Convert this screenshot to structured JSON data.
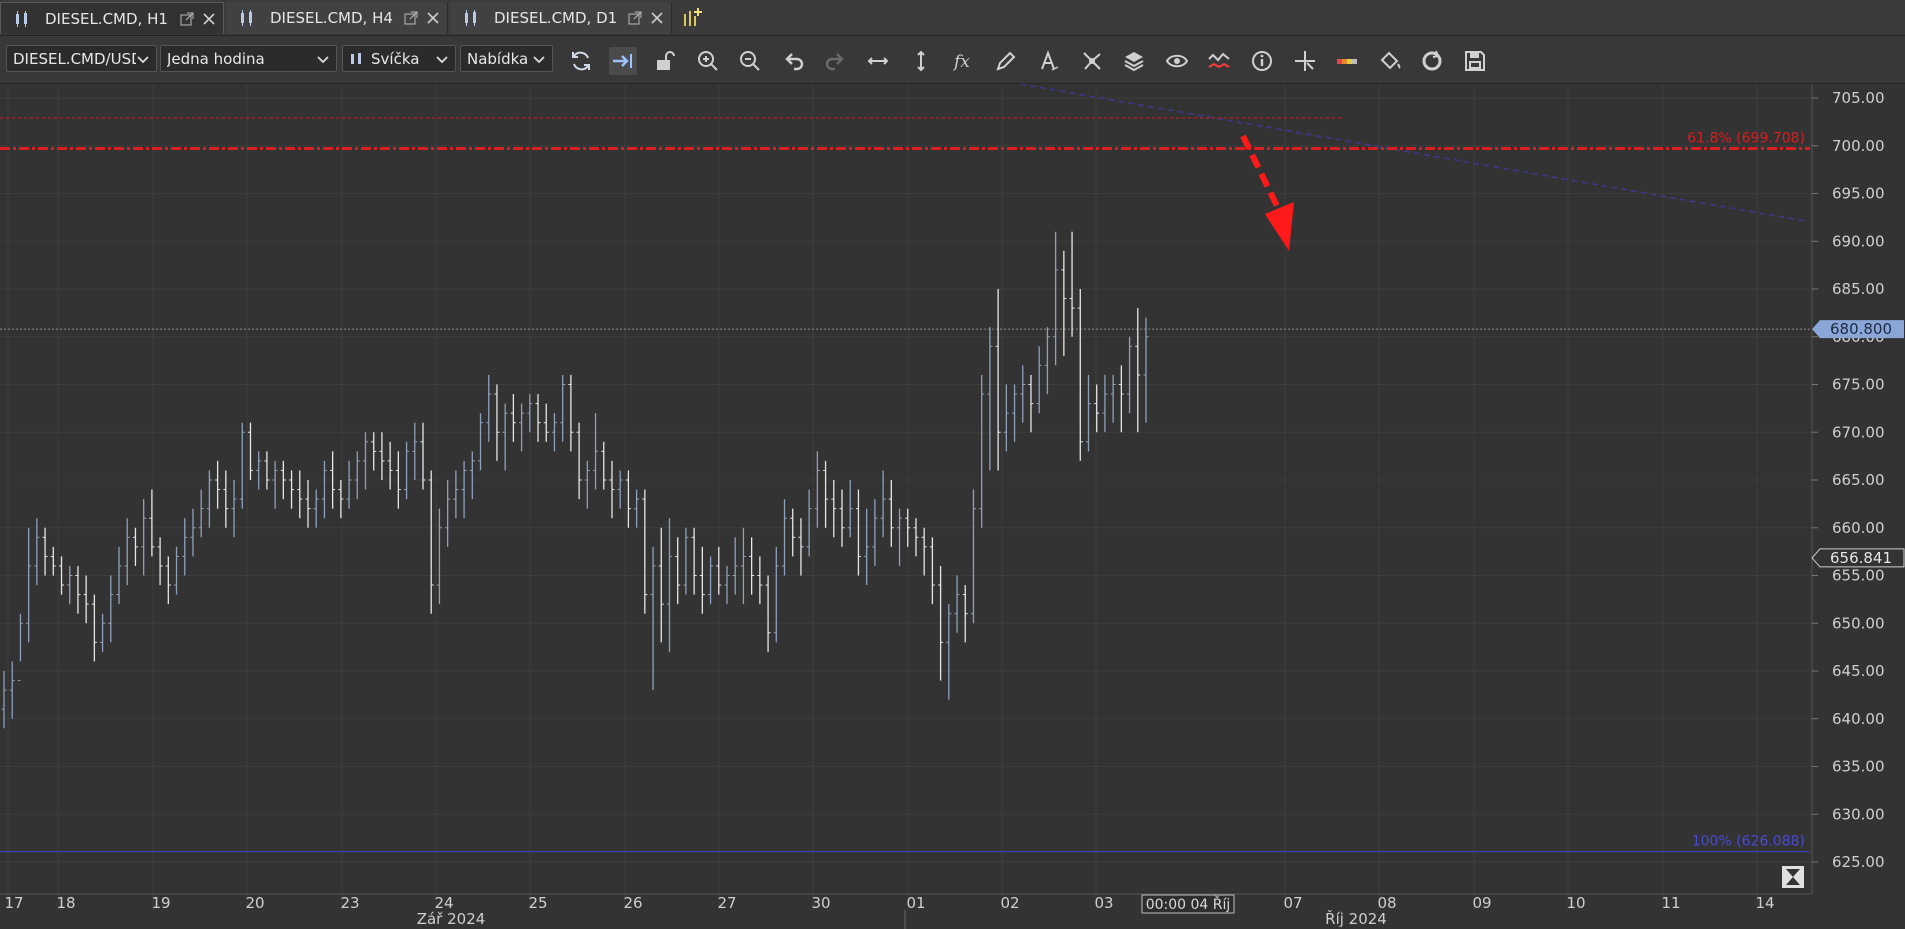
{
  "tabs": [
    {
      "label": "DIESEL.CMD, H1",
      "active": true
    },
    {
      "label": "DIESEL.CMD, H4",
      "active": false
    },
    {
      "label": "DIESEL.CMD, D1",
      "active": false
    }
  ],
  "toolbar": {
    "instrument": "DIESEL.CMD/USD",
    "period": "Jedna hodina",
    "chart_type": "Svíčka",
    "offer_side": "Nabídka",
    "tools": [
      "refresh-icon",
      "shift-right-icon",
      "unlock-icon",
      "zoom-in-icon",
      "zoom-out-icon",
      "undo-icon",
      "redo-icon",
      "horizontal-resize-icon",
      "vertical-resize-icon",
      "function-icon",
      "pencil-icon",
      "text-tool-icon",
      "network-icon",
      "layers-icon",
      "eye-icon",
      "indicator-icon",
      "info-icon",
      "crosshair-icon",
      "palette-bar-icon",
      "paint-bucket-icon",
      "reload-icon",
      "save-icon"
    ]
  },
  "colors": {
    "background": "#333333",
    "bar": "#8fa0bb",
    "bar_light": "#e6e6e6",
    "fib_618": "#d81e1e",
    "fib_100": "#4040c8",
    "trendline": "#3a3a8a",
    "arrow": "#ff1a1a",
    "current_price_bg": "#8aa6d6"
  },
  "price_axis": {
    "ticks": [
      "705.00",
      "700.00",
      "695.00",
      "690.00",
      "685.00",
      "680.00",
      "675.00",
      "670.00",
      "665.00",
      "660.00",
      "655.00",
      "650.00",
      "645.00",
      "640.00",
      "635.00",
      "630.00",
      "625.00"
    ],
    "current_price": "680.800",
    "last_price": "656.841"
  },
  "fib_levels": [
    {
      "label": "61.8% (699.708)",
      "price": 699.708
    },
    {
      "label": "100% (626.088)",
      "price": 626.088
    }
  ],
  "date_axis": {
    "days": [
      "17",
      "18",
      "19",
      "20",
      "23",
      "24",
      "25",
      "26",
      "27",
      "30",
      "01",
      "02",
      "03",
      "07",
      "08",
      "09",
      "10",
      "11",
      "14"
    ],
    "cursor_label": "00:00 04 Říj",
    "months": [
      "Zář 2024",
      "Říj 2024"
    ]
  },
  "chart_data": {
    "type": "ohlc",
    "ylim": [
      622.5,
      707.0
    ],
    "x_categories": [
      "17",
      "18",
      "19",
      "20",
      "23",
      "24",
      "25",
      "26",
      "27",
      "30",
      "01",
      "02",
      "03"
    ],
    "bars": [
      [
        641,
        645,
        639,
        643
      ],
      [
        643,
        646,
        640,
        644
      ],
      [
        644,
        651,
        646,
        650
      ],
      [
        650,
        660,
        648,
        656
      ],
      [
        656,
        661,
        654,
        659
      ],
      [
        659,
        660,
        655,
        657
      ],
      [
        657,
        658,
        655,
        656
      ],
      [
        656,
        657,
        653,
        654
      ],
      [
        654,
        656,
        652,
        655
      ],
      [
        655,
        656,
        651,
        653
      ],
      [
        653,
        655,
        650,
        652
      ],
      [
        652,
        653,
        646,
        648
      ],
      [
        648,
        651,
        647,
        650
      ],
      [
        650,
        655,
        648,
        653
      ],
      [
        653,
        658,
        652,
        656
      ],
      [
        656,
        661,
        654,
        659
      ],
      [
        659,
        660,
        656,
        658
      ],
      [
        658,
        663,
        655,
        661
      ],
      [
        661,
        664,
        657,
        658
      ],
      [
        658,
        659,
        654,
        656
      ],
      [
        656,
        657,
        652,
        654
      ],
      [
        654,
        658,
        653,
        657
      ],
      [
        657,
        661,
        655,
        659
      ],
      [
        659,
        662,
        657,
        660
      ],
      [
        660,
        664,
        659,
        662
      ],
      [
        662,
        666,
        660,
        665
      ],
      [
        665,
        667,
        662,
        664
      ],
      [
        664,
        666,
        660,
        662
      ],
      [
        662,
        665,
        659,
        663
      ],
      [
        663,
        671,
        662,
        670
      ],
      [
        670,
        671,
        665,
        666
      ],
      [
        666,
        668,
        664,
        667
      ],
      [
        667,
        668,
        664,
        665
      ],
      [
        665,
        667,
        662,
        666
      ],
      [
        666,
        667,
        663,
        665
      ],
      [
        665,
        666,
        662,
        664
      ],
      [
        664,
        666,
        661,
        663
      ],
      [
        663,
        665,
        660,
        662
      ],
      [
        662,
        664,
        660,
        663
      ],
      [
        663,
        667,
        661,
        666
      ],
      [
        666,
        668,
        662,
        664
      ],
      [
        664,
        665,
        661,
        663
      ],
      [
        663,
        667,
        662,
        665
      ],
      [
        665,
        668,
        663,
        667
      ],
      [
        667,
        670,
        664,
        669
      ],
      [
        669,
        670,
        666,
        668
      ],
      [
        668,
        670,
        665,
        667
      ],
      [
        667,
        669,
        664,
        666
      ],
      [
        666,
        668,
        662,
        664
      ],
      [
        664,
        669,
        663,
        668
      ],
      [
        668,
        671,
        665,
        669
      ],
      [
        669,
        671,
        664,
        665
      ],
      [
        665,
        666,
        651,
        654
      ],
      [
        654,
        662,
        652,
        660
      ],
      [
        660,
        665,
        658,
        663
      ],
      [
        663,
        666,
        661,
        664
      ],
      [
        664,
        667,
        661,
        666
      ],
      [
        666,
        668,
        663,
        667
      ],
      [
        667,
        672,
        666,
        671
      ],
      [
        671,
        676,
        669,
        674
      ],
      [
        674,
        675,
        667,
        670
      ],
      [
        670,
        673,
        666,
        672
      ],
      [
        672,
        674,
        669,
        671
      ],
      [
        671,
        673,
        668,
        672
      ],
      [
        672,
        674,
        670,
        673
      ],
      [
        673,
        674,
        669,
        671
      ],
      [
        671,
        673,
        669,
        670
      ],
      [
        670,
        672,
        668,
        671
      ],
      [
        671,
        676,
        669,
        675
      ],
      [
        675,
        676,
        668,
        670
      ],
      [
        670,
        671,
        663,
        665
      ],
      [
        665,
        667,
        662,
        666
      ],
      [
        666,
        672,
        664,
        668
      ],
      [
        668,
        669,
        664,
        665
      ],
      [
        665,
        667,
        661,
        664
      ],
      [
        664,
        666,
        662,
        665
      ],
      [
        665,
        666,
        660,
        662
      ],
      [
        662,
        664,
        660,
        663
      ],
      [
        663,
        664,
        651,
        653
      ],
      [
        653,
        658,
        643,
        656
      ],
      [
        656,
        660,
        648,
        652
      ],
      [
        652,
        661,
        647,
        657
      ],
      [
        657,
        659,
        652,
        654
      ],
      [
        654,
        660,
        653,
        659
      ],
      [
        659,
        660,
        653,
        655
      ],
      [
        655,
        658,
        651,
        653
      ],
      [
        653,
        657,
        652,
        656
      ],
      [
        656,
        658,
        653,
        654
      ],
      [
        654,
        656,
        652,
        655
      ],
      [
        655,
        659,
        653,
        656
      ],
      [
        656,
        660,
        652,
        657
      ],
      [
        657,
        659,
        653,
        655
      ],
      [
        655,
        657,
        652,
        654
      ],
      [
        654,
        655,
        647,
        649
      ],
      [
        649,
        658,
        648,
        656
      ],
      [
        656,
        663,
        655,
        661
      ],
      [
        661,
        662,
        657,
        659
      ],
      [
        659,
        661,
        655,
        658
      ],
      [
        658,
        664,
        657,
        662
      ],
      [
        662,
        668,
        660,
        666
      ],
      [
        666,
        667,
        660,
        663
      ],
      [
        663,
        665,
        659,
        662
      ],
      [
        662,
        664,
        658,
        660
      ],
      [
        660,
        665,
        659,
        662
      ],
      [
        662,
        664,
        655,
        657
      ],
      [
        657,
        662,
        654,
        658
      ],
      [
        658,
        663,
        656,
        661
      ],
      [
        661,
        666,
        659,
        663
      ],
      [
        663,
        665,
        658,
        660
      ],
      [
        660,
        662,
        656,
        661
      ],
      [
        661,
        662,
        658,
        660
      ],
      [
        660,
        661,
        657,
        659
      ],
      [
        659,
        660,
        655,
        658
      ],
      [
        658,
        659,
        652,
        654
      ],
      [
        654,
        656,
        644,
        648
      ],
      [
        648,
        652,
        642,
        651
      ],
      [
        651,
        655,
        649,
        653
      ],
      [
        653,
        654,
        648,
        651
      ],
      [
        651,
        664,
        650,
        662
      ],
      [
        662,
        676,
        660,
        674
      ],
      [
        674,
        681,
        666,
        679
      ],
      [
        679,
        685,
        666,
        670
      ],
      [
        670,
        675,
        668,
        672
      ],
      [
        672,
        675,
        669,
        674
      ],
      [
        674,
        677,
        671,
        675
      ],
      [
        675,
        676,
        670,
        673
      ],
      [
        673,
        679,
        672,
        677
      ],
      [
        677,
        681,
        674,
        680
      ],
      [
        680,
        691,
        677,
        687
      ],
      [
        687,
        689,
        678,
        684
      ],
      [
        684,
        691,
        680,
        683
      ],
      [
        683,
        685,
        667,
        669
      ],
      [
        669,
        676,
        668,
        673
      ],
      [
        673,
        675,
        670,
        672
      ],
      [
        672,
        676,
        670,
        674
      ],
      [
        674,
        676,
        671,
        675
      ],
      [
        675,
        677,
        670,
        674
      ],
      [
        674,
        680,
        672,
        679
      ],
      [
        679,
        683,
        670,
        676
      ],
      [
        676,
        682,
        671,
        680
      ]
    ]
  }
}
